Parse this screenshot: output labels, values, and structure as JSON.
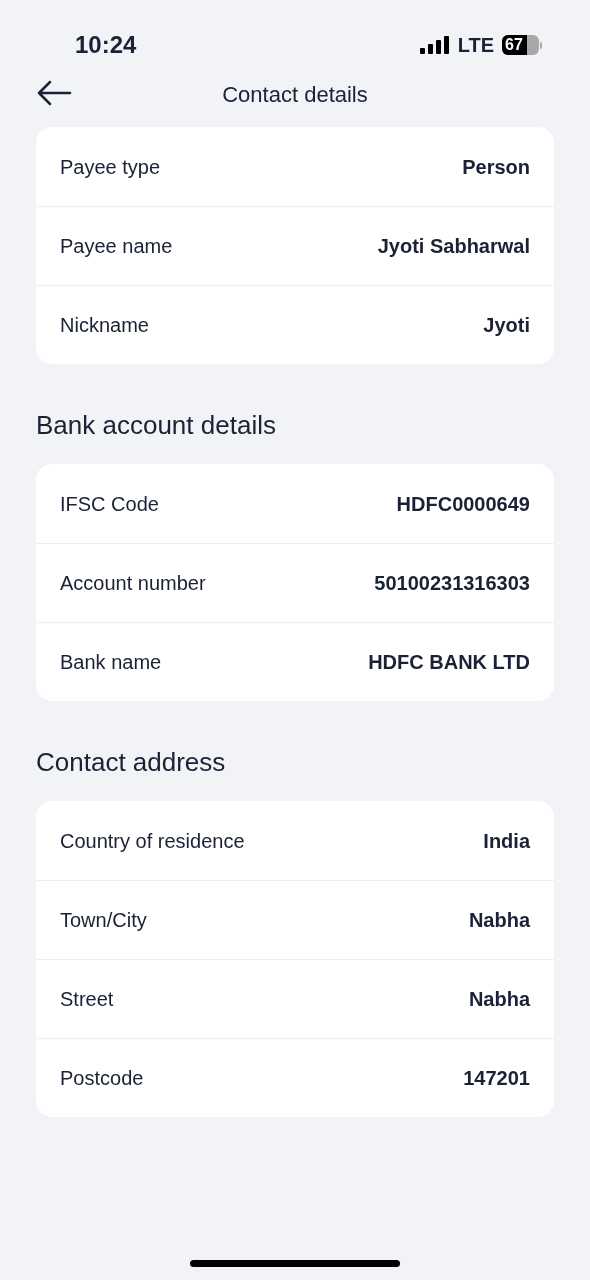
{
  "status_bar": {
    "time": "10:24",
    "network": "LTE",
    "battery": "67"
  },
  "header": {
    "title": "Contact details"
  },
  "sections": [
    {
      "rows": [
        {
          "label": "Payee type",
          "value": "Person"
        },
        {
          "label": "Payee name",
          "value": "Jyoti Sabharwal"
        },
        {
          "label": "Nickname",
          "value": "Jyoti"
        }
      ]
    },
    {
      "heading": "Bank account details",
      "rows": [
        {
          "label": "IFSC Code",
          "value": "HDFC0000649"
        },
        {
          "label": "Account number",
          "value": "50100231316303"
        },
        {
          "label": "Bank name",
          "value": "HDFC BANK LTD"
        }
      ]
    },
    {
      "heading": "Contact address",
      "rows": [
        {
          "label": "Country of residence",
          "value": "India"
        },
        {
          "label": "Town/City",
          "value": "Nabha"
        },
        {
          "label": "Street",
          "value": "Nabha"
        },
        {
          "label": "Postcode",
          "value": "147201"
        }
      ]
    }
  ]
}
